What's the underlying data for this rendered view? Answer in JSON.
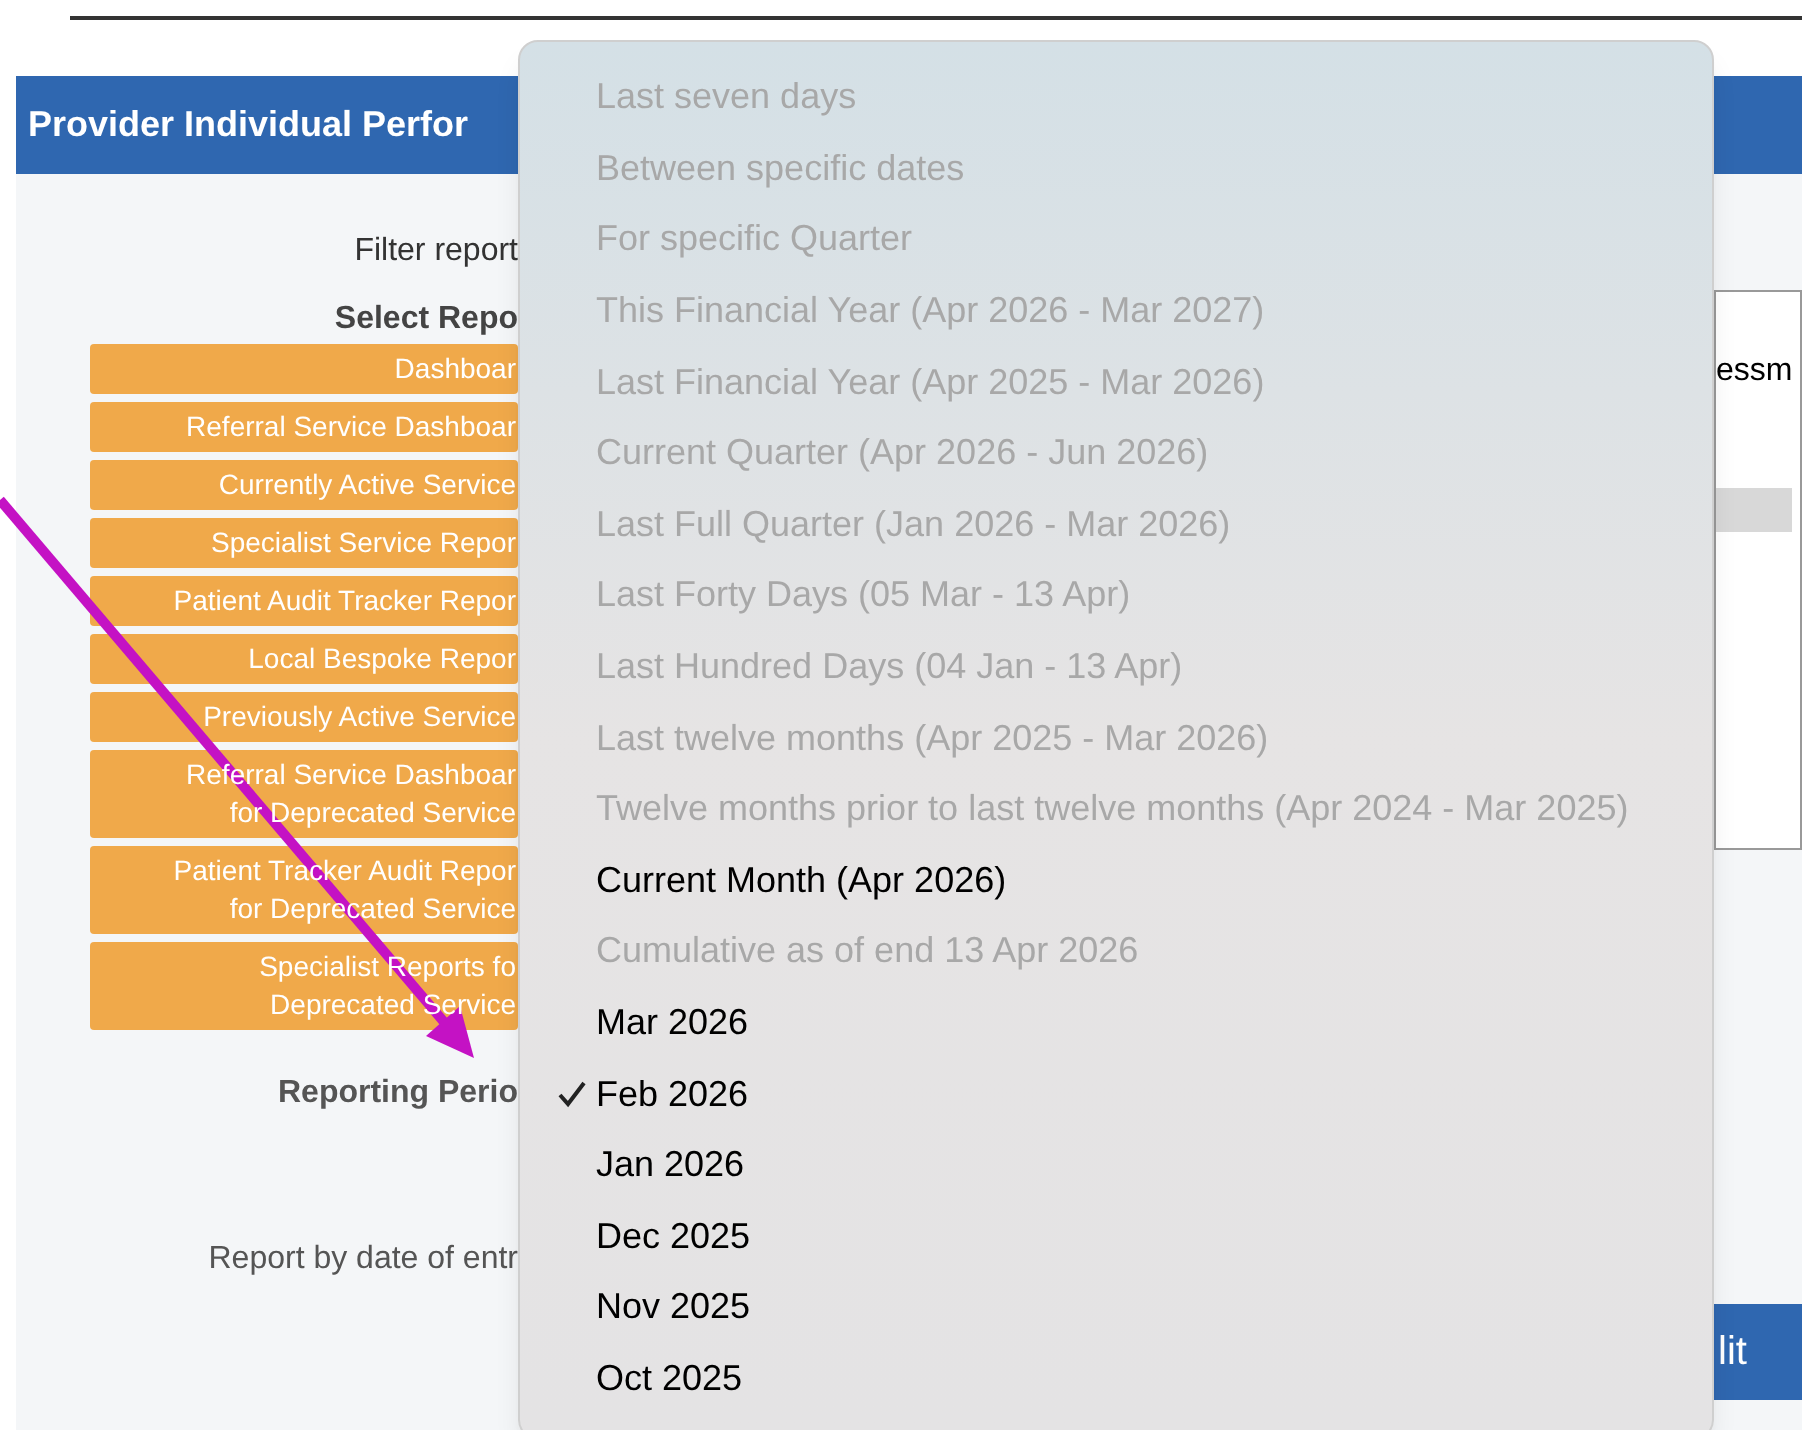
{
  "header": {
    "title": "Provider Individual Perfor"
  },
  "filter_label": "Filter report",
  "select_label": "Select Repo",
  "report_buttons": [
    {
      "lines": [
        "Dashboar"
      ]
    },
    {
      "lines": [
        "Referral Service Dashboar"
      ]
    },
    {
      "lines": [
        "Currently Active Service"
      ]
    },
    {
      "lines": [
        "Specialist Service Repor"
      ]
    },
    {
      "lines": [
        "Patient Audit Tracker Repor"
      ]
    },
    {
      "lines": [
        "Local Bespoke Repor"
      ]
    },
    {
      "lines": [
        "Previously Active Service"
      ]
    },
    {
      "lines": [
        "Referral Service Dashboar",
        "for Deprecated Service"
      ]
    },
    {
      "lines": [
        "Patient Tracker Audit Repor",
        "for Deprecated Service"
      ]
    },
    {
      "lines": [
        "Specialist Reports fo",
        "Deprecated Service"
      ]
    }
  ],
  "reporting_period_label": "Reporting Perio",
  "date_of_entry_label": "Report by date of entr",
  "right_panel": {
    "text": "essm",
    "button": "lit"
  },
  "period_menu": [
    {
      "label": "Last seven days",
      "disabled": true,
      "selected": false
    },
    {
      "label": "Between specific dates",
      "disabled": true,
      "selected": false
    },
    {
      "label": "For specific Quarter",
      "disabled": true,
      "selected": false
    },
    {
      "label": "This Financial Year (Apr 2026 - Mar 2027)",
      "disabled": true,
      "selected": false
    },
    {
      "label": "Last Financial Year (Apr 2025 - Mar 2026)",
      "disabled": true,
      "selected": false
    },
    {
      "label": "Current Quarter (Apr 2026 - Jun 2026)",
      "disabled": true,
      "selected": false
    },
    {
      "label": "Last Full Quarter (Jan 2026 - Mar 2026)",
      "disabled": true,
      "selected": false
    },
    {
      "label": "Last Forty Days (05 Mar - 13 Apr)",
      "disabled": true,
      "selected": false
    },
    {
      "label": "Last Hundred Days (04 Jan - 13 Apr)",
      "disabled": true,
      "selected": false
    },
    {
      "label": "Last twelve months (Apr 2025 - Mar 2026)",
      "disabled": true,
      "selected": false
    },
    {
      "label": "Twelve months prior to last twelve months (Apr 2024 - Mar 2025)",
      "disabled": true,
      "selected": false
    },
    {
      "label": "Current Month (Apr 2026)",
      "disabled": false,
      "selected": false
    },
    {
      "label": "Cumulative as of end 13 Apr 2026",
      "disabled": true,
      "selected": false
    },
    {
      "label": "Mar 2026",
      "disabled": false,
      "selected": false
    },
    {
      "label": "Feb 2026",
      "disabled": false,
      "selected": true
    },
    {
      "label": "Jan 2026",
      "disabled": false,
      "selected": false
    },
    {
      "label": "Dec 2025",
      "disabled": false,
      "selected": false
    },
    {
      "label": "Nov 2025",
      "disabled": false,
      "selected": false
    },
    {
      "label": "Oct 2025",
      "disabled": false,
      "selected": false
    }
  ]
}
